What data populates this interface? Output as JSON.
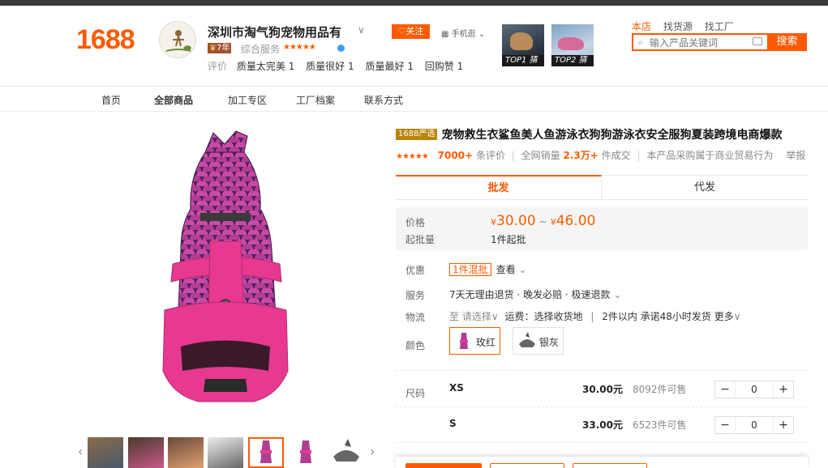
{
  "site": {
    "logo": "1688"
  },
  "shop": {
    "name": "深圳市淘气狗宠物用品有",
    "years": "7年",
    "service_label": "综合服务",
    "service_stars": "★★★★★",
    "ratings_label": "评价",
    "ratings": [
      {
        "label": "质量太完美",
        "count": "1"
      },
      {
        "label": "质量很好",
        "count": "1"
      },
      {
        "label": "质量最好",
        "count": "1"
      },
      {
        "label": "回购赞",
        "count": "1"
      }
    ],
    "follow": "关注",
    "mobile": "手机逛"
  },
  "top_products": [
    {
      "caption": "TOP1 猜"
    },
    {
      "caption": "TOP2 猜"
    }
  ],
  "search": {
    "tabs": [
      "本店",
      "找货源",
      "找工厂"
    ],
    "placeholder": "输入产品关键词",
    "button": "搜索"
  },
  "nav": {
    "items": [
      "首页",
      "全部商品",
      "加工专区",
      "工厂档案",
      "联系方式"
    ]
  },
  "product": {
    "badge": "1688严选",
    "title": "宠物救生衣鲨鱼美人鱼游泳衣狗狗游泳衣安全服狗夏装跨境电商爆款",
    "stars": "★★★★★",
    "reviews": "7000+",
    "reviews_label": "条评价",
    "sales_label": "全网销量",
    "sales": "2.3万+",
    "sales_unit": "件成交",
    "note": "本产品采购属于商业贸易行为",
    "report": "举报",
    "tabs": [
      "批发",
      "代发"
    ],
    "price_label": "价格",
    "currency": "¥",
    "price_low": "30.00",
    "price_sep": "~",
    "price_high": "46.00",
    "moq_label": "起批量",
    "moq": "1件起批",
    "promo_label": "优惠",
    "promo_tag": "1件混批",
    "promo_link": "查看",
    "service_label": "服务",
    "service": "7天无理由退货 · 晚发必赔 · 极速退款",
    "logistics_label": "物流",
    "logistics_to": "至",
    "logistics_choose": "请选择",
    "logistics_fee": "运费：选择收货地",
    "logistics_ship": "2件以内 承诺48小时发货",
    "logistics_more": "更多",
    "color_label": "颜色",
    "colors": [
      "玫红",
      "银灰"
    ],
    "size_label": "尺码",
    "sizes": [
      {
        "size": "XS",
        "price": "30.00元",
        "stock": "8092件可售",
        "qty": "0"
      },
      {
        "size": "S",
        "price": "33.00元",
        "stock": "6523件可售",
        "qty": "0"
      }
    ]
  },
  "colors": {
    "accent": "#ff5a00",
    "badge": "#b8860b",
    "pink": "#e6398f",
    "purple": "#5a2a6e"
  }
}
